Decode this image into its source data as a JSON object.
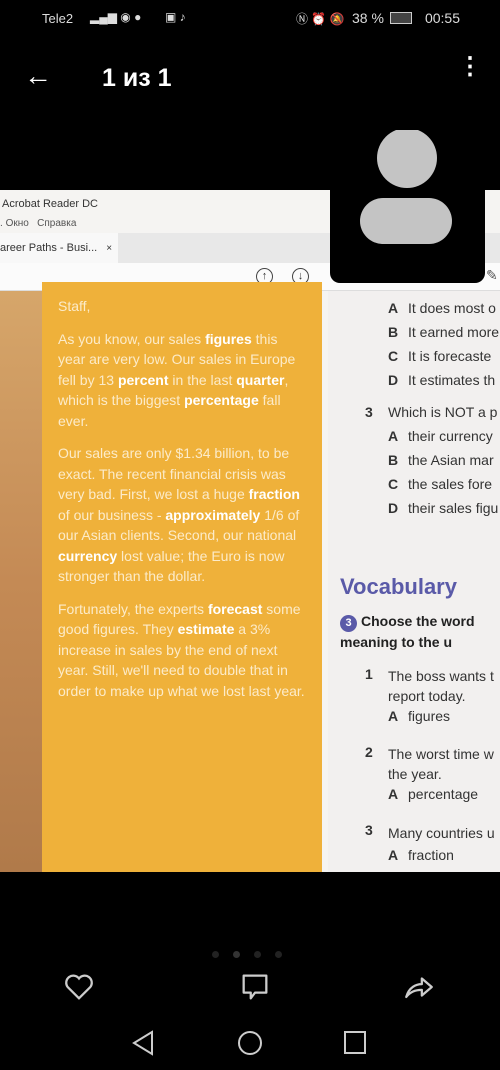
{
  "status_bar": {
    "carrier": "Tele2",
    "battery": "38 %",
    "time": "00:55"
  },
  "app_bar": {
    "title": "1 из 1"
  },
  "photo": {
    "acrobat": {
      "title": "Acrobat Reader DC",
      "menu": [
        "Окно",
        "Справка"
      ],
      "tab": "areer Paths - Busi...",
      "tab_close": "×"
    },
    "letter": {
      "salutation": "Staff,",
      "paragraphs": [
        [
          "As you know, our sales ",
          {
            "b": "figures"
          },
          " this year are very low. Our sales in Europe fell by 13 ",
          {
            "b": "percent"
          },
          " in the last ",
          {
            "b": "quarter"
          },
          ", which is the biggest ",
          {
            "b": "percentage"
          },
          " fall ever."
        ],
        [
          "Our sales are only $1.34 billion, to be exact. The recent financial crisis was very bad. First, we lost a huge ",
          {
            "b": "fraction"
          },
          " of our business - ",
          {
            "b": "approximately"
          },
          " 1/6 of our Asian clients. Second, our national ",
          {
            "b": "currency"
          },
          " lost value; the Euro is now stronger than the dollar."
        ],
        [
          "Fortunately, the experts ",
          {
            "b": "forecast"
          },
          " some good figures. They ",
          {
            "b": "estimate"
          },
          " a 3% increase in sales by the end of next year. Still, we'll need to double that in order to make up what we lost last year."
        ]
      ]
    },
    "questions": {
      "q2_options": [
        {
          "k": "A",
          "t": "It does most o"
        },
        {
          "k": "B",
          "t": "It earned more"
        },
        {
          "k": "C",
          "t": "It is forecaste"
        },
        {
          "k": "D",
          "t": "It estimates th"
        }
      ],
      "q3": {
        "n": "3",
        "t": "Which is NOT a p"
      },
      "q3_options": [
        {
          "k": "A",
          "t": "their currency"
        },
        {
          "k": "B",
          "t": "the Asian mar"
        },
        {
          "k": "C",
          "t": "the sales fore"
        },
        {
          "k": "D",
          "t": "their sales figu"
        }
      ]
    },
    "vocabulary": {
      "heading": "Vocabulary",
      "badge": "3",
      "instruction_1": "Choose the word",
      "instruction_2": "meaning to the u",
      "items": [
        {
          "n": "1",
          "l1": "The boss wants t",
          "l2": "report today.",
          "a": "A",
          "opt": "figures"
        },
        {
          "n": "2",
          "l1": "The worst time w",
          "l2": "the year.",
          "a": "A",
          "opt": "percentage"
        },
        {
          "n": "3",
          "l1": "Many countries u",
          "a": "A",
          "opt": "fraction"
        }
      ]
    }
  },
  "colors": {
    "letter_bg": "#efb13a",
    "vocab_accent": "#5a5aa8"
  }
}
